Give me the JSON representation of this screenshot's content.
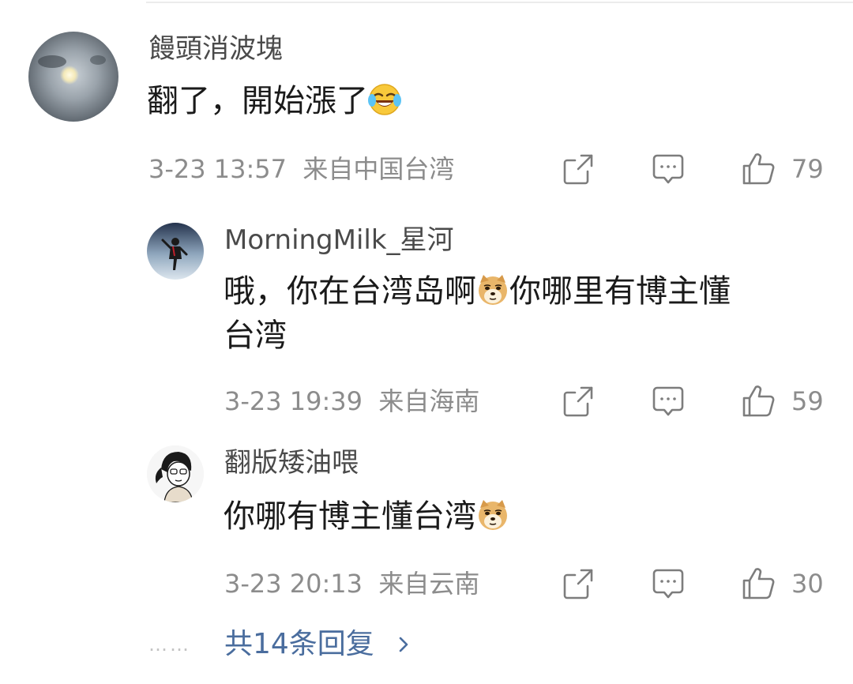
{
  "comments": [
    {
      "username": "饅頭消波塊",
      "text": "翻了，開始漲了",
      "emoji": "laughing-crying-emoji",
      "date": "3-23 13:57",
      "location": "来自中国台湾",
      "likes": "79"
    },
    {
      "username": "MorningMilk_星河",
      "text_line1": "哦，你在台湾岛啊",
      "emoji": "doge-emoji",
      "text_line1_after": "你哪里有博主懂",
      "text_line2": "台湾",
      "date": "3-23 19:39",
      "location": "来自海南",
      "likes": "59"
    },
    {
      "username": "翻版矮油喂",
      "text": "你哪有博主懂台湾",
      "emoji": "doge-emoji",
      "date": "3-23 20:13",
      "location": "来自云南",
      "likes": "30"
    }
  ],
  "more_replies": {
    "dots": "……",
    "label": "共14条回复"
  },
  "icons": {
    "share": "share-icon",
    "reply": "comment-icon",
    "like": "thumbs-up-icon",
    "chevron": "chevron-right-icon"
  },
  "colors": {
    "link": "#4a6d9e",
    "meta": "#8c8c8c",
    "username": "#4a4a4a"
  }
}
